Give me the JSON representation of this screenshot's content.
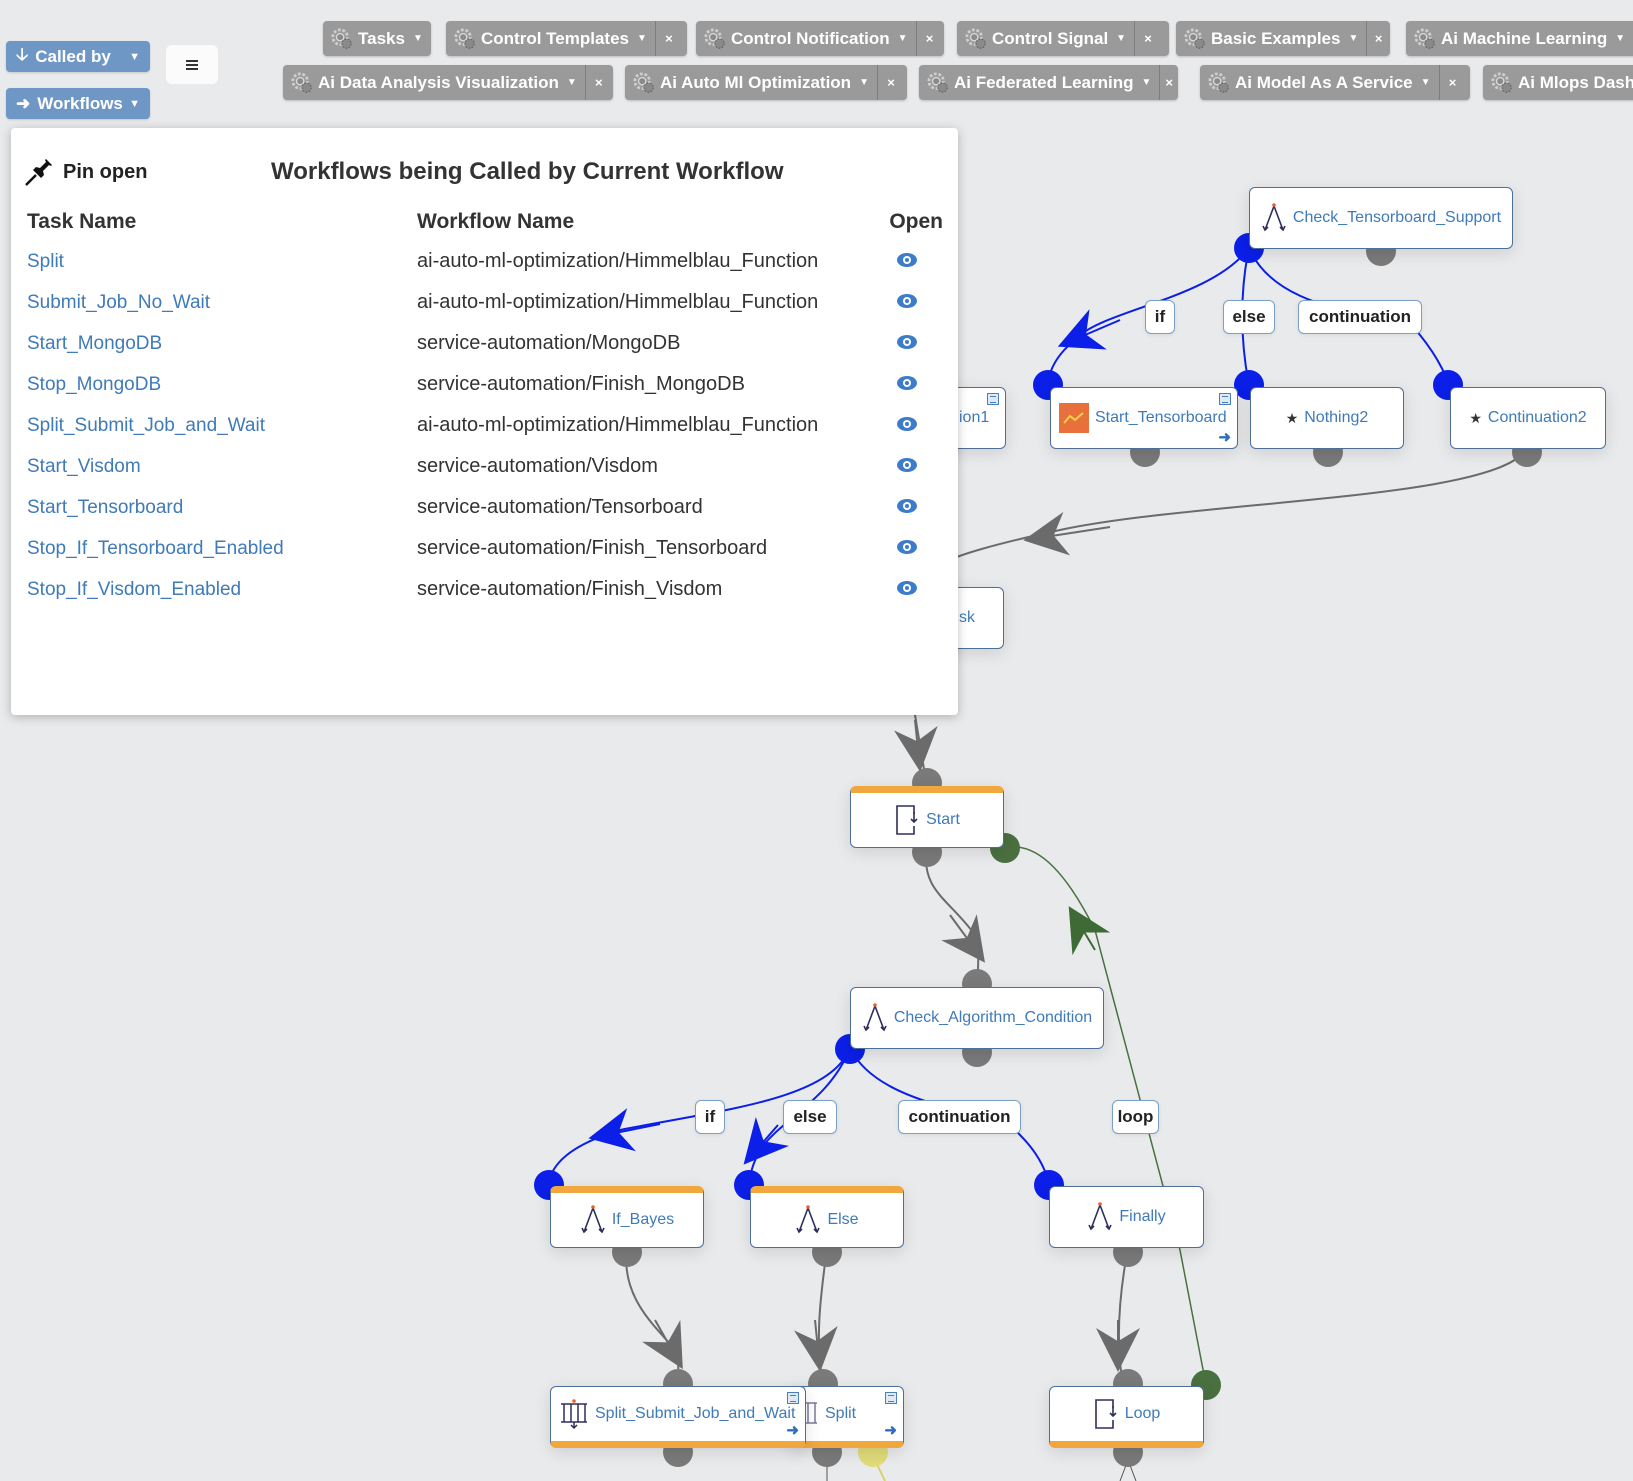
{
  "left_controls": {
    "called_by": {
      "label": "Called by",
      "icon": "arrow-down-icon"
    },
    "workflows": {
      "label": "Workflows",
      "icon": "arrow-right-icon"
    },
    "menu": {
      "icon": "menu-icon"
    }
  },
  "buckets_row1": [
    {
      "label": "Tasks",
      "closable": false
    },
    {
      "label": "Control Templates",
      "closable": true
    },
    {
      "label": "Control Notification",
      "closable": true
    },
    {
      "label": "Control Signal",
      "closable": true
    },
    {
      "label": "Basic Examples",
      "closable": true
    },
    {
      "label": "Ai Machine Learning",
      "closable": false
    }
  ],
  "buckets_row2": [
    {
      "label": "Ai Data Analysis Visualization",
      "closable": true
    },
    {
      "label": "Ai Auto Ml Optimization",
      "closable": true
    },
    {
      "label": "Ai Federated Learning",
      "closable": true
    },
    {
      "label": "Ai Model As A Service",
      "closable": true
    },
    {
      "label": "Ai Mlops Dash",
      "closable": false
    }
  ],
  "close_glyph": "×",
  "caret_glyph": "▼",
  "popup": {
    "pin_label": "Pin open",
    "title": "Workflows being Called by Current Workflow",
    "columns": [
      "Task Name",
      "Workflow Name",
      "Open"
    ],
    "rows": [
      {
        "task": "Split",
        "workflow": "ai-auto-ml-optimization/Himmelblau_Function"
      },
      {
        "task": "Submit_Job_No_Wait",
        "workflow": "ai-auto-ml-optimization/Himmelblau_Function"
      },
      {
        "task": "Start_MongoDB",
        "workflow": "service-automation/MongoDB"
      },
      {
        "task": "Stop_MongoDB",
        "workflow": "service-automation/Finish_MongoDB"
      },
      {
        "task": "Split_Submit_Job_and_Wait",
        "workflow": "ai-auto-ml-optimization/Himmelblau_Function"
      },
      {
        "task": "Start_Visdom",
        "workflow": "service-automation/Visdom"
      },
      {
        "task": "Start_Tensorboard",
        "workflow": "service-automation/Tensorboard"
      },
      {
        "task": "Stop_If_Tensorboard_Enabled",
        "workflow": "service-automation/Finish_Tensorboard"
      },
      {
        "task": "Stop_If_Visdom_Enabled",
        "workflow": "service-automation/Finish_Visdom"
      }
    ]
  },
  "nodes": {
    "check_tensorboard_support": "Check_Tensorboard_Support",
    "partial_ion1": "ion1",
    "start_tensorboard": "Start_Tensorboard",
    "nothing2": "Nothing2",
    "continuation2": "Continuation2",
    "partial_sk": "sk",
    "start": "Start",
    "check_algorithm_condition": "Check_Algorithm_Condition",
    "if_bayes": "If_Bayes",
    "else": "Else",
    "finally": "Finally",
    "split_submit_job_and_wait": "Split_Submit_Job_and_Wait",
    "split": "Split",
    "loop": "Loop"
  },
  "edge_labels": {
    "if_1": "if",
    "else_1": "else",
    "continuation_1": "continuation",
    "if_2": "if",
    "else_2": "else",
    "continuation_2": "continuation",
    "loop": "loop"
  },
  "colors": {
    "canvas": "#e9eaec",
    "button_blue": "#6f97c6",
    "bucket_gray": "#9a9a9a",
    "link_blue": "#3f7ab9",
    "branch_blue": "#0b1fe8",
    "loop_green": "#4a7040",
    "node_bar_orange": "#f0a73d",
    "endpoint_gray": "#7a7a7a"
  }
}
